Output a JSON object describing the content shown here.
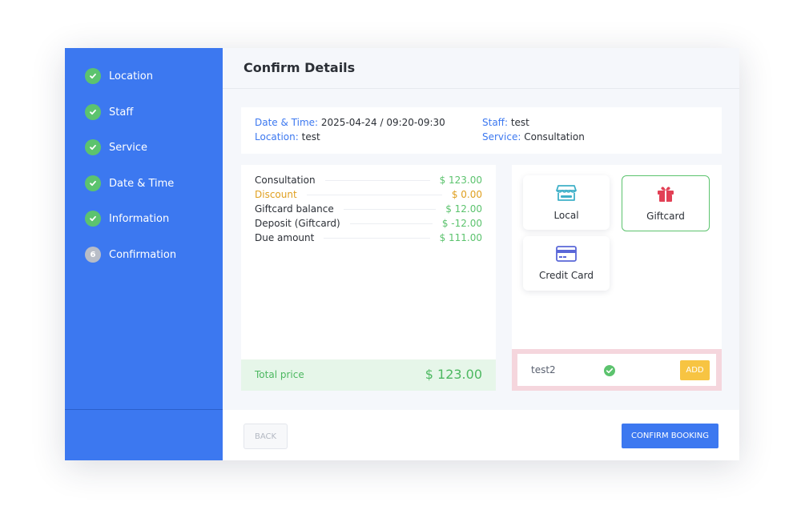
{
  "steps": [
    {
      "label": "Location",
      "status": "done"
    },
    {
      "label": "Staff",
      "status": "done"
    },
    {
      "label": "Service",
      "status": "done"
    },
    {
      "label": "Date & Time",
      "status": "done"
    },
    {
      "label": "Information",
      "status": "done"
    },
    {
      "label": "Confirmation",
      "status": "current",
      "number": "6"
    }
  ],
  "header": {
    "title": "Confirm Details"
  },
  "summary": {
    "datetime_label": "Date & Time:",
    "datetime_value": "2025-04-24 / 09:20-09:30",
    "location_label": "Location:",
    "location_value": "test",
    "staff_label": "Staff:",
    "staff_value": "test",
    "service_label": "Service:",
    "service_value": "Consultation"
  },
  "cost": {
    "rows": [
      {
        "name": "Consultation",
        "value": "$ 123.00"
      },
      {
        "name": "Discount",
        "value": "$ 0.00"
      },
      {
        "name": "Giftcard balance",
        "value": "$ 12.00"
      },
      {
        "name": "Deposit (Giftcard)",
        "value": "$ -12.00"
      },
      {
        "name": "Due amount",
        "value": "$ 111.00"
      }
    ],
    "total_label": "Total price",
    "total_value": "$ 123.00"
  },
  "payment": {
    "methods": [
      {
        "label": "Local",
        "icon": "store-icon",
        "selected": false
      },
      {
        "label": "Giftcard",
        "icon": "gift-icon",
        "selected": true
      },
      {
        "label": "Credit Card",
        "icon": "credit-card-icon",
        "selected": false
      }
    ],
    "giftcard_code": "test2",
    "add_label": "ADD"
  },
  "footer": {
    "back_label": "BACK",
    "confirm_label": "CONFIRM BOOKING"
  },
  "colors": {
    "primary": "#3c78f0",
    "success": "#5cc36e",
    "warning": "#f7c442",
    "discount": "#e0a020"
  }
}
